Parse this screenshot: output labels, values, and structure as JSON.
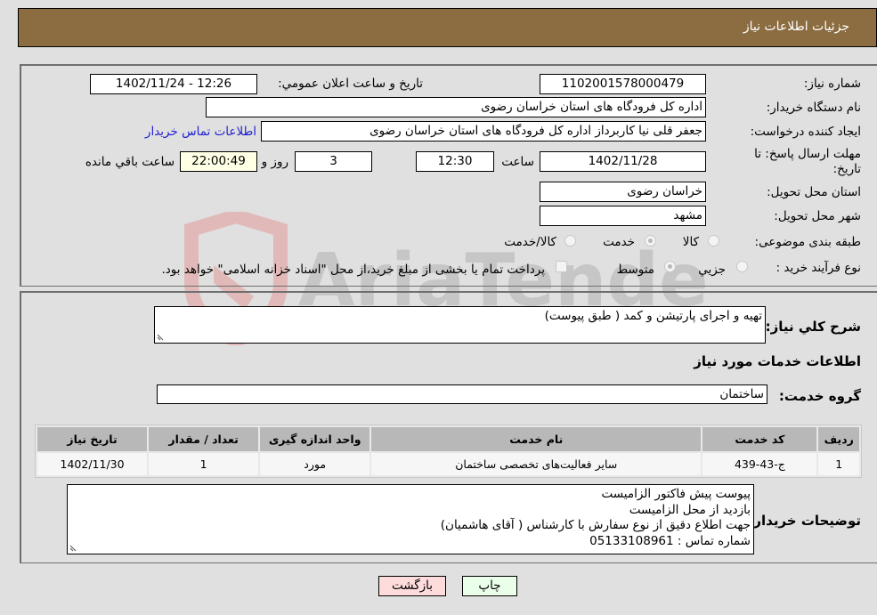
{
  "header": {
    "title": "جزئیات اطلاعات نیاز"
  },
  "details": {
    "need_number_label": "شماره نیاز:",
    "need_number": "1102001578000479",
    "announce_label": "تاریخ و ساعت اعلان عمومي:",
    "announce_value": "1402/11/24 - 12:26",
    "buyer_org_label": "نام دستگاه خریدار:",
    "buyer_org": "اداره کل فرودگاه های استان خراسان رضوی",
    "creator_label": "ایجاد کننده درخواست:",
    "creator": "جعفر قلی نیا کاربرداز اداره کل فرودگاه های استان خراسان رضوی",
    "contact_link": "اطلاعات تماس خریدار",
    "deadline_label_line1": "مهلت ارسال پاسخ: تا",
    "deadline_label_line2": "تاریخ:",
    "deadline_date": "1402/11/28",
    "time_label": "ساعت",
    "deadline_time": "12:30",
    "days_value": "3",
    "days_label": "روز و",
    "remaining_time": "22:00:49",
    "remaining_label": "ساعت باقي مانده",
    "province_label": "استان محل تحویل:",
    "province": "خراسان رضوی",
    "city_label": "شهر محل تحویل:",
    "city": "مشهد",
    "category_label": "طبقه بندی موضوعی:",
    "category_options": [
      {
        "label": "کالا",
        "checked": false
      },
      {
        "label": "خدمت",
        "checked": true
      },
      {
        "label": "کالا/خدمت",
        "checked": false
      }
    ],
    "process_label": "نوع فرآیند خرید :",
    "process_options": [
      {
        "label": "جزيي",
        "checked": false
      },
      {
        "label": "متوسط",
        "checked": true
      }
    ],
    "treasury_note": "پرداخت تمام یا بخشی از مبلغ خرید،از محل \"اسناد خزانه اسلامی\" خواهد بود.",
    "treasury_checked": false
  },
  "services": {
    "description_label": "شرح کلي نياز:",
    "description": "تهیه و اجرای پارتیشن و کمد ( طبق پیوست)",
    "section_title": "اطلاعات خدمات مورد نياز",
    "group_label": "گروه خدمت:",
    "group_value": "ساختمان",
    "table": {
      "headers": [
        "ردیف",
        "کد خدمت",
        "نام خدمت",
        "واحد اندازه گیری",
        "تعداد / مقدار",
        "تاریخ نیاز"
      ],
      "rows": [
        [
          "1",
          "ج-43-439",
          "سایر فعالیت‌های تخصصی ساختمان",
          "مورد",
          "1",
          "1402/11/30"
        ]
      ]
    },
    "buyer_notes_label": "توضیحات خریدار:",
    "buyer_notes": [
      "پیوست پیش فاکتور الزامیست",
      "بازدید از محل الزامیست",
      "جهت اطلاع دقیق از نوع سفارش با کارشناس   ( آقای هاشمیان)",
      "شماره تماس :  05133108961"
    ]
  },
  "buttons": {
    "print": "چاپ",
    "back": "بازگشت"
  },
  "watermark": {
    "text": "AriaTender.neT",
    "color": "#e8a0a0"
  }
}
